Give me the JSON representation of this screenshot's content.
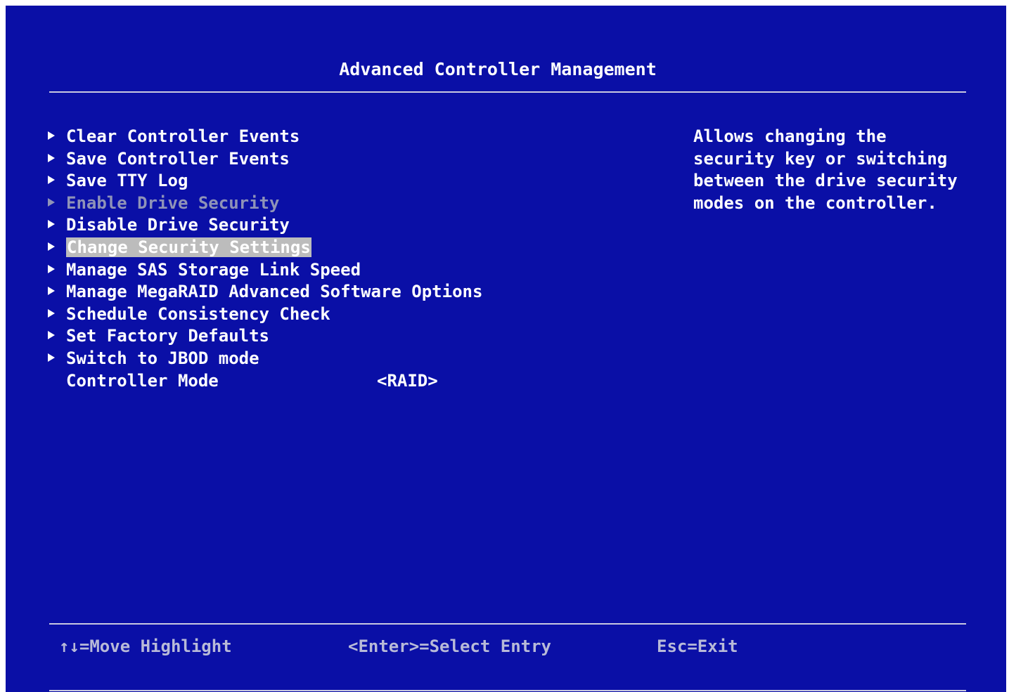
{
  "screen": {
    "title": "Advanced Controller Management"
  },
  "menu": {
    "items": [
      {
        "label": "Clear Controller Events"
      },
      {
        "label": "Save Controller Events"
      },
      {
        "label": "Save TTY Log"
      },
      {
        "label": "Enable Drive Security",
        "disabled": true
      },
      {
        "label": "Disable Drive Security"
      },
      {
        "label": "Change Security Settings",
        "selected": true
      },
      {
        "label": "Manage SAS Storage Link Speed"
      },
      {
        "label": "Manage MegaRAID Advanced Software Options"
      },
      {
        "label": "Schedule Consistency Check"
      },
      {
        "label": "Set Factory Defaults"
      },
      {
        "label": "Switch to JBOD mode"
      }
    ],
    "controller_mode": {
      "label": "Controller Mode",
      "value": "<RAID>"
    }
  },
  "help": {
    "text": "Allows changing the security key or switching between the drive security modes on the controller."
  },
  "footer": {
    "move": "↑↓=Move Highlight",
    "select": "<Enter>=Select Entry",
    "exit": "Esc=Exit"
  },
  "colors": {
    "background": "#0a0fa6",
    "text": "#ffffff",
    "disabled_text": "#8f93b8",
    "selection_highlight": "#bcbcbc",
    "hint_text": "#b8bad8"
  }
}
